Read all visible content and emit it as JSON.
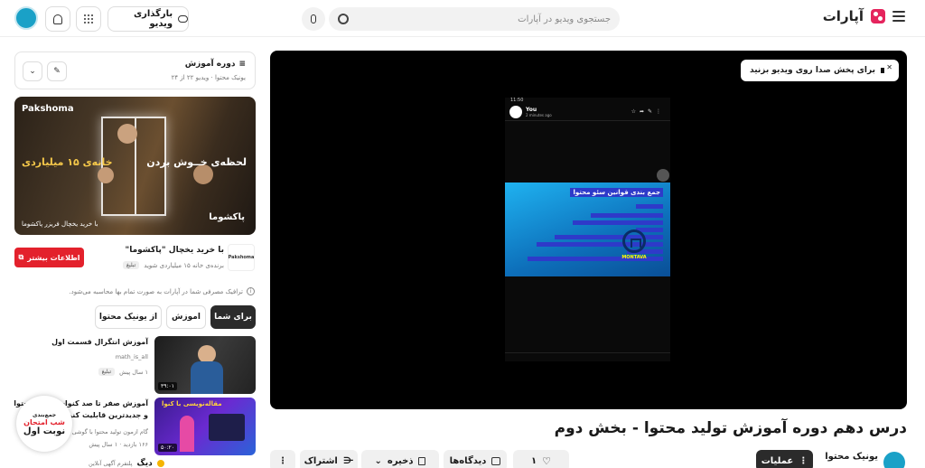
{
  "header": {
    "logo_text": "آپارات",
    "search_placeholder": "جستجوی ویدیو در آپارات",
    "upload_label": "بارگذاری ویدیو"
  },
  "player": {
    "sound_hint": "برای پخش صدا روی ویدیو بزنید",
    "inner_screen": {
      "time": "11:50",
      "channel": "You",
      "ago": "2 minutes ago",
      "slide_title": "جمع بندی قوانین سئو محتوا",
      "logo_label": "MONTAVA"
    }
  },
  "video": {
    "title": "درس دهم دوره آموزش تولید محتوا - بخش دوم",
    "channel": "یونیک محتوا",
    "actions": {
      "operations": "عملیات",
      "comments": "دیدگاه‌ها",
      "like_count": "۱",
      "save": "ذخیره",
      "share": "اشتراک"
    }
  },
  "sidebar": {
    "course": {
      "title": "دوره آموزش",
      "channel": "یونیک محتوا",
      "progress": "ویدیو ۲۲ از ۲۴"
    },
    "ad": {
      "brand": "Pakshoma",
      "headline_right": "لحظه‌ی خــوش بردن",
      "headline_left": "خانه‌ی ۱۵ میلیاردی",
      "footer_text": "با خرید یخچال فریزر پاکشوما",
      "footer_logo": "پاکشوما"
    },
    "sponsor": {
      "logo": "Pakshoma",
      "title": "با خرید یخچال \"پاکشوما\"",
      "subtitle": "برنده‌ی خانه ۱۵ میلیاردی شوید",
      "tag": "تبلیغ",
      "button": "اطلاعات بیشتر"
    },
    "notice": "ترافیک مصرفی شما در آپارات به صورت تمام بها محاسبه می‌شود.",
    "chips": [
      "برای شما",
      "اموزش",
      "از یونیک محتوا"
    ],
    "recommendations": [
      {
        "title": "آموزش انتگرال قسمت اول",
        "channel": "math_is_all",
        "meta": "۱ سال پیش",
        "tag": "تبلیغ",
        "duration": "۳۹:۰۱"
      },
      {
        "title": "آموزش صفر تا صد کنوا، نوشتن محتوا و جدیدترین قابلیت کنوا",
        "channel": "گام ازمون تولید محتوا با گوشی",
        "meta": "۱۶۶ بازدید · ۱ سال پیش",
        "duration": "۵۰:۲۰",
        "thumb_text": "مقاله‌نویسی با کنوا"
      }
    ],
    "floating_badge": {
      "line1": "جمع‌بندی",
      "line2": "شب امتحان",
      "line3": "نوبت اول"
    },
    "bottom_ad": {
      "brand": "دیگ",
      "text": "پلتفرم آگهی آنلاین"
    }
  },
  "colors": {
    "accent": "#e5245d",
    "cta_red": "#e3212c",
    "dark_button": "#2b2b2b",
    "channel_avatar": "#1aa1c7"
  }
}
